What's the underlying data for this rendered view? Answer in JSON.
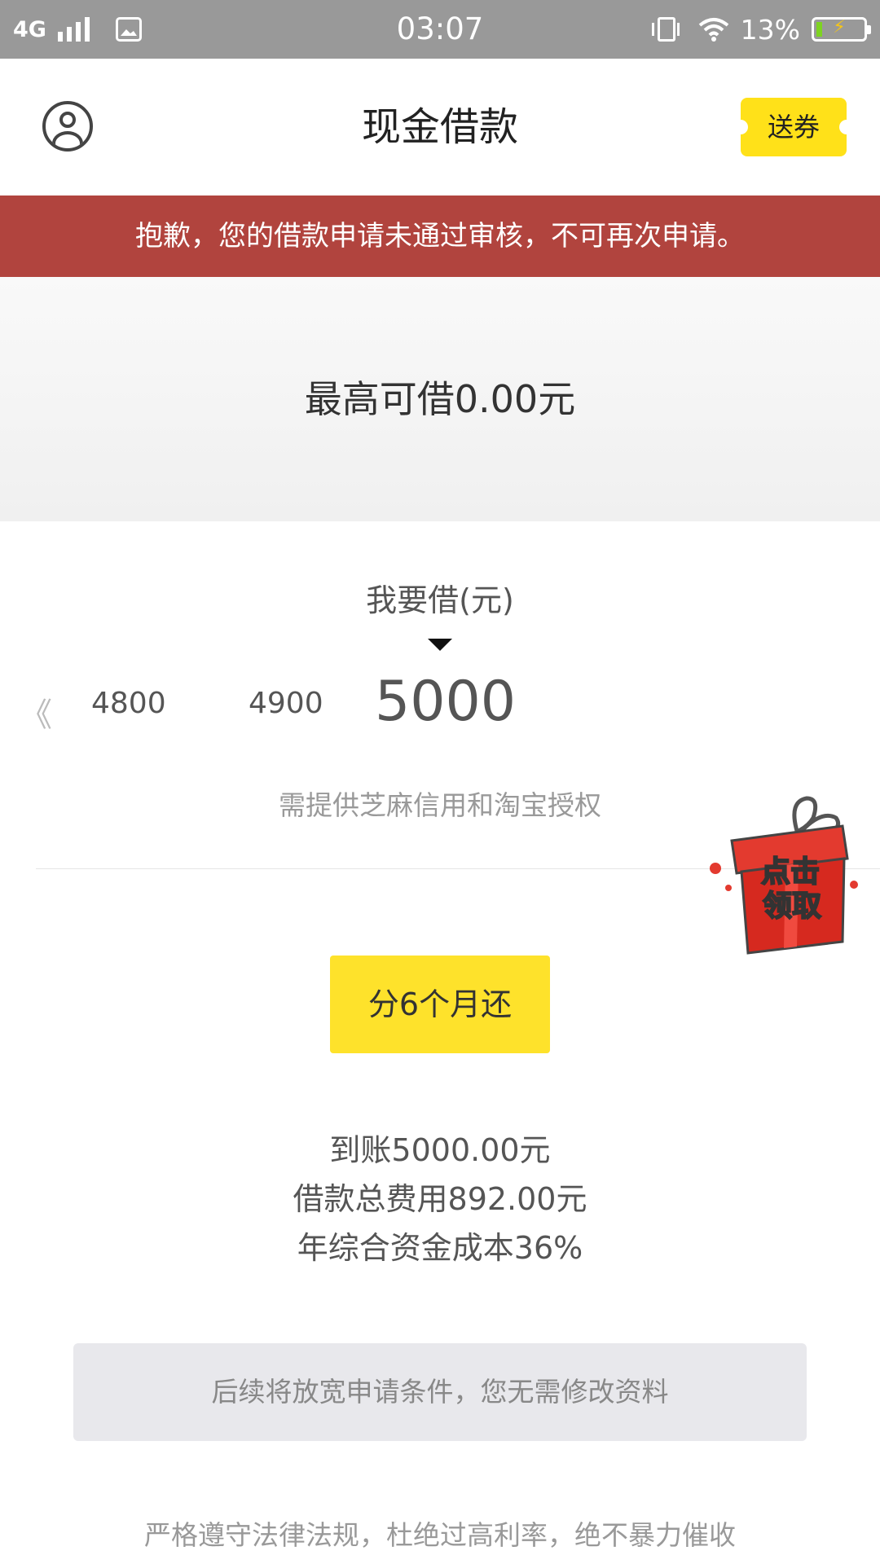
{
  "status_bar": {
    "network": "4G",
    "time": "03:07",
    "battery_percent": "13%",
    "battery_level": 0.13,
    "icons": [
      "signal-icon",
      "gallery-icon",
      "vibrate-icon",
      "wifi-icon",
      "battery-icon"
    ]
  },
  "header": {
    "title": "现金借款",
    "coupon_label": "送券",
    "avatar_icon": "user-avatar-icon"
  },
  "banner": {
    "message": "抱歉，您的借款申请未通过审核，不可再次申请。"
  },
  "credit": {
    "max_text": "最高可借0.00元"
  },
  "borrow": {
    "label": "我要借(元)",
    "left_arrow": "《",
    "options": [
      "4800",
      "4900"
    ],
    "selected": "5000",
    "hint": "需提供芝麻信用和淘宝授权"
  },
  "gift": {
    "line1": "点击",
    "line2": "领取"
  },
  "installment": {
    "label": "分6个月还"
  },
  "summary": {
    "received": "到账5000.00元",
    "total_fee": "借款总费用892.00元",
    "annual_cost": "年综合资金成本36%"
  },
  "notice": {
    "text": "后续将放宽申请条件，您无需修改资料"
  },
  "footer": {
    "text": "严格遵守法律法规，杜绝过高利率，绝不暴力催收"
  },
  "colors": {
    "banner_bg": "#b1443e",
    "accent_yellow": "#fee22b",
    "status_bar_bg": "#999999"
  }
}
